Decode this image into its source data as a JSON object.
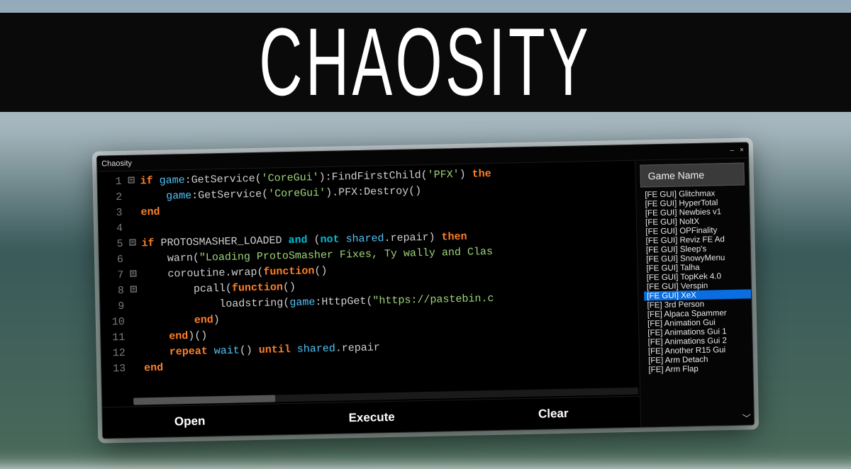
{
  "banner": {
    "title": "CHAOSITY"
  },
  "window": {
    "title": "Chaosity",
    "controls": {
      "minimize": "–",
      "close": "×"
    }
  },
  "editor": {
    "lines": [
      {
        "n": 1,
        "fold": true,
        "html": "<span class='kw'>if</span> <span class='ident'>game</span>:GetService(<span class='str'>'CoreGui'</span>):FindFirstChild(<span class='str'>'PFX'</span>) <span class='kw'>the</span>"
      },
      {
        "n": 2,
        "fold": false,
        "html": "    <span class='ident'>game</span>:GetService(<span class='str'>'CoreGui'</span>).PFX:Destroy()"
      },
      {
        "n": 3,
        "fold": false,
        "html": "<span class='kw'>end</span>"
      },
      {
        "n": 4,
        "fold": false,
        "html": ""
      },
      {
        "n": 5,
        "fold": true,
        "html": "<span class='kw'>if</span> PROTOSMASHER_LOADED <span class='kw2'>and</span> (<span class='kw2'>not</span> <span class='ident'>shared</span>.repair) <span class='kw'>then</span>"
      },
      {
        "n": 6,
        "fold": false,
        "html": "    warn(<span class='str'>\"Loading ProtoSmasher Fixes, Ty wally and Clas</span>"
      },
      {
        "n": 7,
        "fold": true,
        "html": "    coroutine.wrap(<span class='kw'>function</span>()"
      },
      {
        "n": 8,
        "fold": true,
        "html": "        pcall(<span class='kw'>function</span>()"
      },
      {
        "n": 9,
        "fold": false,
        "html": "            loadstring(<span class='ident'>game</span>:HttpGet(<span class='str'>\"https://pastebin.c</span>"
      },
      {
        "n": 10,
        "fold": false,
        "html": "        <span class='kw'>end</span>)"
      },
      {
        "n": 11,
        "fold": false,
        "html": "    <span class='kw'>end</span>)()"
      },
      {
        "n": 12,
        "fold": false,
        "html": "    <span class='kw'>repeat</span> <span class='ident'>wait</span>() <span class='kw'>until</span> <span class='ident'>shared</span>.repair"
      },
      {
        "n": 13,
        "fold": false,
        "html": "<span class='kw'>end</span>"
      }
    ]
  },
  "sidebar": {
    "header": "Game Name",
    "items": [
      {
        "label": "[FE GUI] Glitchmax",
        "selected": false
      },
      {
        "label": "[FE GUI] HyperTotal",
        "selected": false
      },
      {
        "label": "[FE GUI] Newbies v1",
        "selected": false
      },
      {
        "label": "[FE GUI] NoltX",
        "selected": false
      },
      {
        "label": "[FE GUI] OPFinality",
        "selected": false
      },
      {
        "label": "[FE GUI] Reviz FE Ad",
        "selected": false
      },
      {
        "label": "[FE GUI] Sleep's",
        "selected": false
      },
      {
        "label": "[FE GUI] SnowyMenu",
        "selected": false
      },
      {
        "label": "[FE GUI] Talha",
        "selected": false
      },
      {
        "label": "[FE GUI] TopKek 4.0",
        "selected": false
      },
      {
        "label": "[FE GUI] Verspin",
        "selected": false
      },
      {
        "label": "[FE GUI] XeX",
        "selected": true
      },
      {
        "label": "[FE] 3rd Person",
        "selected": false
      },
      {
        "label": "[FE] Alpaca Spammer",
        "selected": false
      },
      {
        "label": "[FE] Animation Gui",
        "selected": false
      },
      {
        "label": "[FE] Animations Gui 1",
        "selected": false
      },
      {
        "label": "[FE] Animations Gui 2",
        "selected": false
      },
      {
        "label": "[FE] Another R15 Gui",
        "selected": false
      },
      {
        "label": "[FE] Arm Detach",
        "selected": false
      },
      {
        "label": "[FE] Arm Flap",
        "selected": false
      }
    ]
  },
  "buttons": {
    "open": "Open",
    "execute": "Execute",
    "clear": "Clear"
  }
}
